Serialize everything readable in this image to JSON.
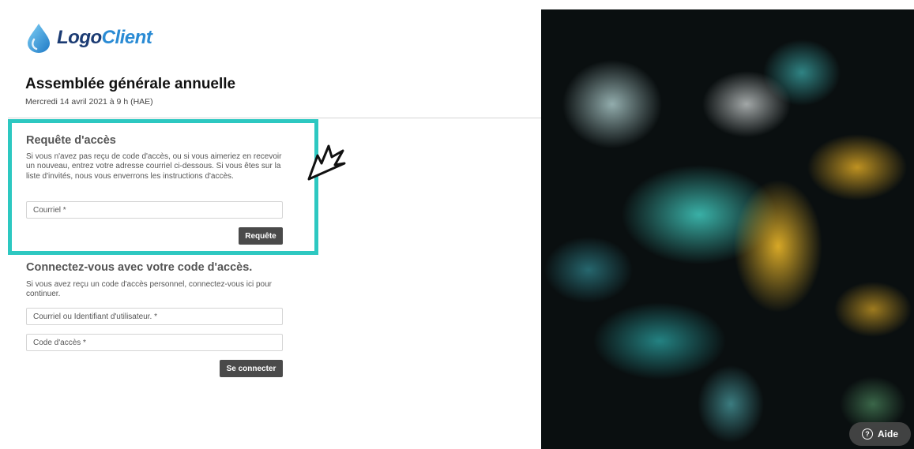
{
  "brand": {
    "logo_part1": "Logo",
    "logo_part2": "Client"
  },
  "event": {
    "title": "Assemblée générale annuelle",
    "date": "Mercredi 14 avril 2021 à 9 h (HAE)"
  },
  "request_access": {
    "title": "Requête d'accès",
    "description": "Si vous n'avez pas reçu de code d'accès, ou si vous aimeriez en recevoir un nouveau, entrez votre adresse courriel ci-dessous. Si vous êtes sur la liste d'invités, nous vous enverrons les instructions d'accès.",
    "email_placeholder": "Courriel *",
    "button_label": "Requête"
  },
  "login": {
    "title": "Connectez-vous avec votre code d'accès.",
    "description": "Si vous avez reçu un code d'accès personnel, connectez-vous ici pour continuer.",
    "user_placeholder": "Courriel ou Identifiant d'utilisateur. *",
    "code_placeholder": "Code d'accès *",
    "button_label": "Se connecter"
  },
  "help": {
    "label": "Aide",
    "icon_glyph": "?"
  },
  "colors": {
    "highlight": "#2dc8c1",
    "button": "#4a4a4a",
    "logo_dark": "#1b3b73",
    "logo_light": "#2a8bd4"
  },
  "icons": [
    "drop-logo-icon",
    "pointer-arrow-icon",
    "help-circle-icon"
  ]
}
